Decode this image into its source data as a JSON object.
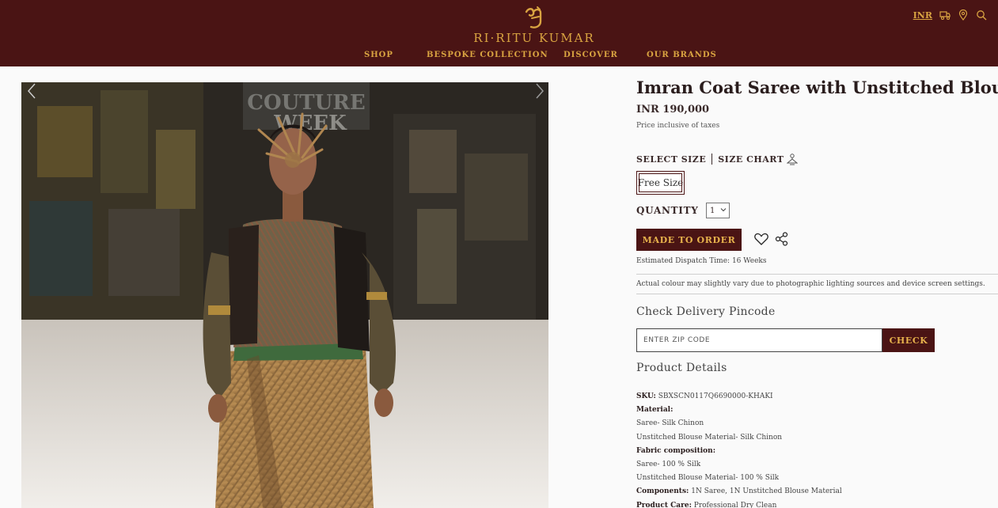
{
  "header": {
    "brand_name": "RI·RITU KUMAR",
    "currency": "INR",
    "nav": [
      "SHOP",
      "BESPOKE COLLECTION",
      "DISCOVER",
      "OUR BRANDS"
    ],
    "icons": [
      "truck-icon",
      "location-pin-icon",
      "search-icon"
    ]
  },
  "gallery": {
    "backdrop_text_line1": "COUTURE",
    "backdrop_text_line2": "WEEK"
  },
  "product": {
    "title": "Imran Coat Saree with Unstitched Blouse",
    "price": "INR 190,000",
    "tax_note": "Price inclusive of taxes",
    "select_size_label": "SELECT SIZE",
    "size_chart_label": "SIZE CHART",
    "size_option": "Free Size",
    "quantity_label": "QUANTITY",
    "quantity_value": "1",
    "order_button": "MADE TO ORDER",
    "dispatch_time": "Estimated Dispatch Time: 16 Weeks",
    "disclaimer": "Actual colour may slightly vary due to photographic lighting sources and device screen settings."
  },
  "delivery": {
    "title": "Check Delivery Pincode",
    "placeholder": "ENTER ZIP CODE",
    "check_button": "CHECK"
  },
  "product_details": {
    "title": "Product Details",
    "sku_label": "SKU:",
    "sku_value": "SBXSCN0117Q6690000-KHAKI",
    "material_label": "Material:",
    "material_saree": "Saree- Silk Chinon",
    "material_blouse": "Unstitched Blouse Material- Silk Chinon",
    "fabric_label": "Fabric composition:",
    "fabric_saree": "Saree- 100 % Silk",
    "fabric_blouse": "Unstitched Blouse Material- 100 % Silk",
    "components_label": "Components:",
    "components_value": "1N Saree, 1N Unstitched Blouse Material",
    "care_label": "Product Care:",
    "care_value": "Professional Dry Clean"
  },
  "colors": {
    "brand_maroon": "#4a1414",
    "brand_gold": "#d9a441"
  }
}
